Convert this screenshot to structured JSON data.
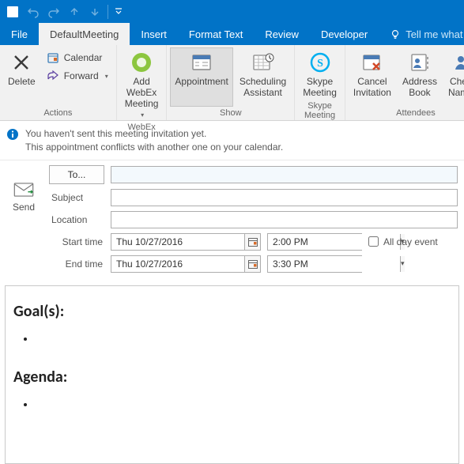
{
  "qat": {
    "icons": [
      "save",
      "undo",
      "redo",
      "up",
      "down"
    ]
  },
  "tabs": {
    "file": "File",
    "active": "DefaultMeeting",
    "others": [
      "Insert",
      "Format Text",
      "Review",
      "Developer"
    ],
    "tell": "Tell me what you"
  },
  "ribbon": {
    "actions": {
      "delete": "Delete",
      "calendar": "Calendar",
      "forward": "Forward",
      "label": "Actions"
    },
    "webex": {
      "add": "Add WebEx",
      "add2": "Meeting",
      "label": "WebEx"
    },
    "show": {
      "appointment": "Appointment",
      "sched1": "Scheduling",
      "sched2": "Assistant",
      "label": "Show"
    },
    "skype": {
      "btn1": "Skype",
      "btn2": "Meeting",
      "label": "Skype Meeting"
    },
    "attendees": {
      "cancel1": "Cancel",
      "cancel2": "Invitation",
      "ab1": "Address",
      "ab2": "Book",
      "chk1": "Check",
      "chk2": "Names",
      "label": "Attendees"
    }
  },
  "info": {
    "line1": "You haven't sent this meeting invitation yet.",
    "line2": "This appointment conflicts with another one on your calendar."
  },
  "form": {
    "send": "Send",
    "to": "To...",
    "subject_label": "Subject",
    "location_label": "Location",
    "subject_value": "",
    "location_value": "",
    "to_value": "",
    "start_label": "Start time",
    "end_label": "End time",
    "start_date": "Thu 10/27/2016",
    "start_time": "2:00 PM",
    "end_date": "Thu 10/27/2016",
    "end_time": "3:30 PM",
    "allday": "All day event",
    "allday_checked": false
  },
  "body": {
    "goals_heading": "Goal(s):",
    "agenda_heading": "Agenda:",
    "goals_items": [
      ""
    ],
    "agenda_items": [
      ""
    ]
  }
}
